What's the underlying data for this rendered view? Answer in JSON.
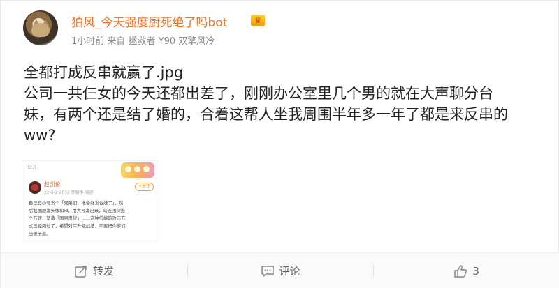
{
  "post": {
    "username": "狛风_今天强度厨死绝了吗bot",
    "badge_icon": "vip-crown-icon",
    "meta": "1小时前 来自 拯救者 Y90 双擎风冷",
    "content_lines": [
      "全都打成反串就赢了.jpg",
      "公司一共仨女的今天还都出差了，刚刚办公室里几个男的就在大声聊分台",
      "妹，有两个还是结了婚的，合着这帮人坐我周围半年多一年了都是来反串的",
      "ww?"
    ]
  },
  "embedded_image": {
    "top_label": "公开",
    "name": "赵凯伦",
    "time": "22-6-2 2032  荣耀手  福建",
    "follow_label": "+关注",
    "lines": [
      "自己登小号发个「兄弟们，准备好发台妹了」，然",
      "后截图跟发头像和id，用大号发出来，勾连团伙抢",
      "个万转，塑造「国男蛊货」……这种低端的攻击方",
      "式已经用过了，希望对岸升级战法，不要把你爹们",
      "当傻子逗。"
    ]
  },
  "actions": {
    "repost": {
      "label": "转发",
      "icon": "repost-icon"
    },
    "comment": {
      "label": "评论",
      "icon": "comment-icon"
    },
    "like": {
      "count": "3",
      "icon": "thumbs-up-icon"
    }
  },
  "colors": {
    "username": "#f56e1e",
    "meta": "#888888",
    "action_text": "#666666"
  }
}
